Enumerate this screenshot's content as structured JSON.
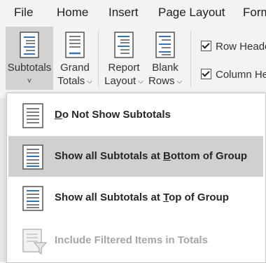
{
  "menubar": {
    "tabs": [
      "File",
      "Home",
      "Insert",
      "Page Layout",
      "Form"
    ]
  },
  "ribbon": {
    "buttons": [
      {
        "line1": "Subtotals",
        "line2": "˅",
        "active": true
      },
      {
        "line1": "Grand",
        "line2": "Totals"
      },
      {
        "line1": "Report",
        "line2": "Layout"
      },
      {
        "line1": "Blank",
        "line2": "Rows"
      }
    ],
    "checkboxes": [
      {
        "label": "Row Heade",
        "checked": true
      },
      {
        "label": "Column He",
        "checked": true
      }
    ]
  },
  "dropdown": {
    "items": [
      {
        "pre": "",
        "accel": "D",
        "post": "o Not Show Subtotals",
        "icon": "table-plain-icon",
        "state": "normal"
      },
      {
        "pre": "Show all Subtotals at ",
        "accel": "B",
        "post": "ottom of Group",
        "icon": "subtotals-bottom-icon",
        "state": "hover"
      },
      {
        "pre": "Show all Subtotals at ",
        "accel": "T",
        "post": "op of Group",
        "icon": "subtotals-top-icon",
        "state": "normal"
      },
      {
        "pre": "Include Filtered Items in Totals",
        "accel": "",
        "post": "",
        "icon": "filter-totals-icon",
        "state": "disabled"
      }
    ]
  },
  "colors": {
    "accent_blue": "#2f75c0",
    "hover_gray": "#d0d0d0",
    "active_button": "#d2d2d2",
    "disabled_text": "#a6a6a6"
  }
}
